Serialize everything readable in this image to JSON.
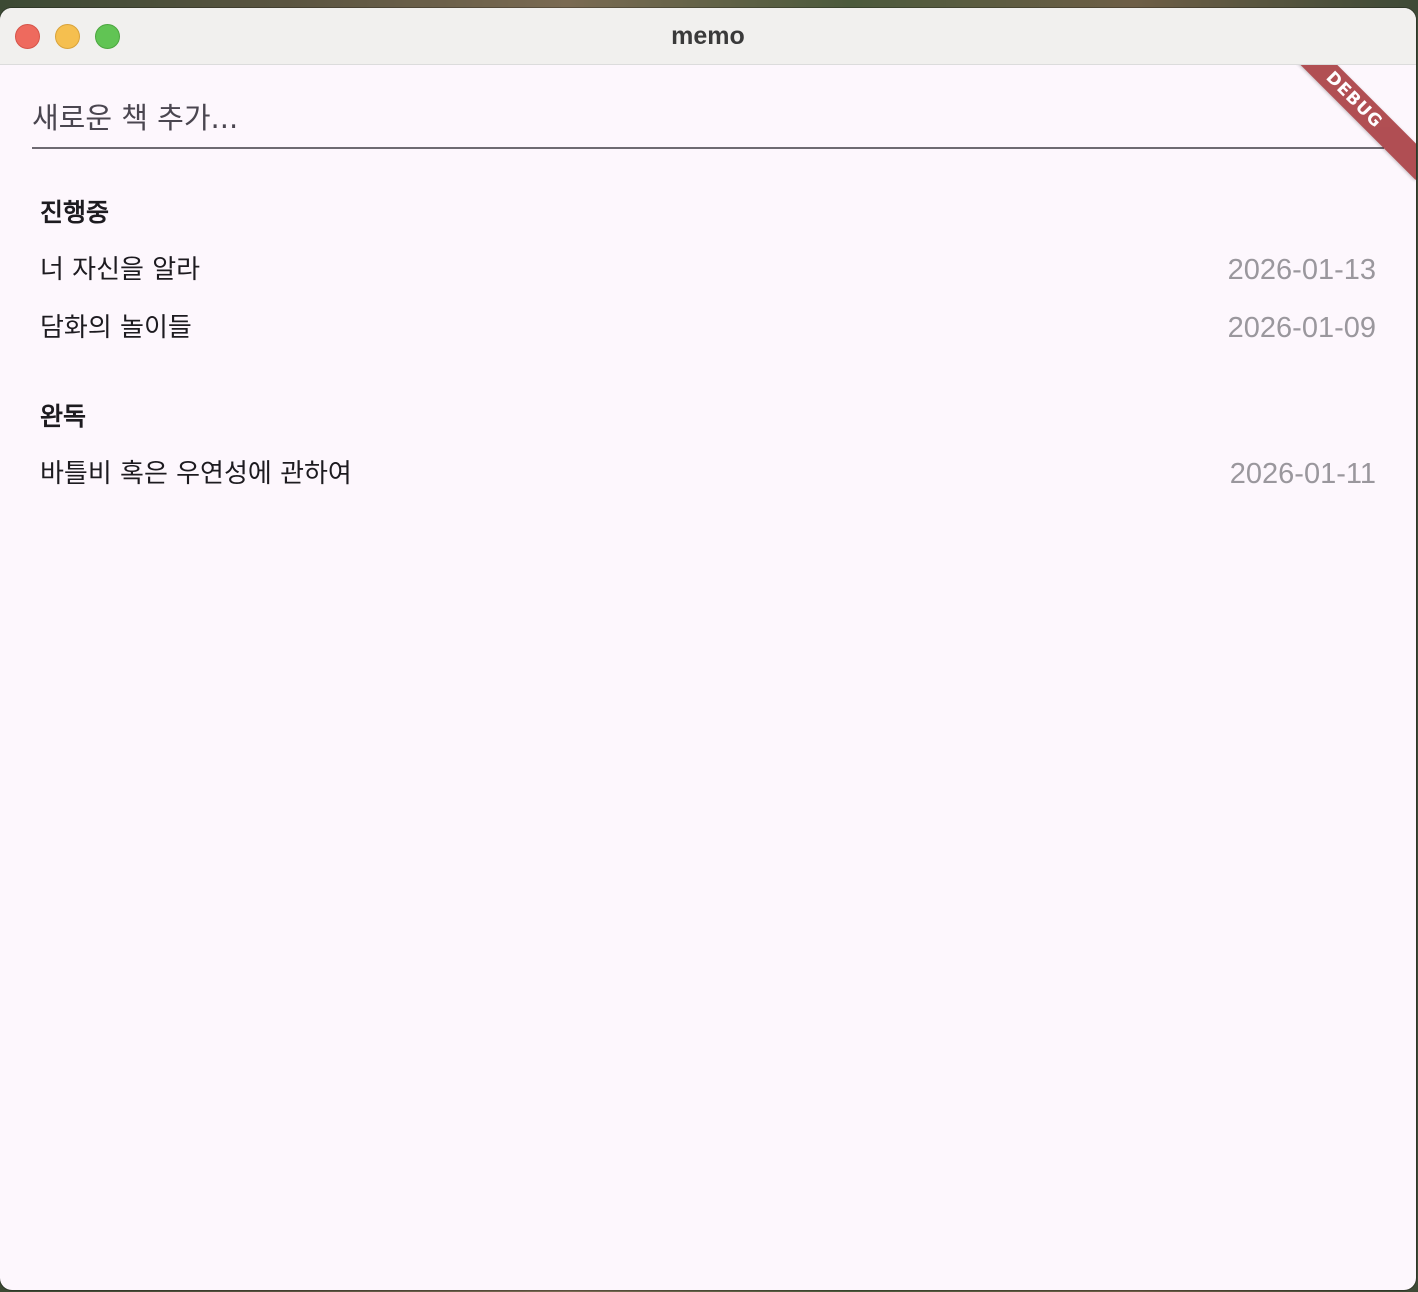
{
  "window": {
    "title": "memo"
  },
  "search": {
    "placeholder": "새로운 책 추가..."
  },
  "debug_banner": "DEBUG",
  "sections": [
    {
      "title": "진행중",
      "books": [
        {
          "title": "너 자신을 알라",
          "date": "2026-01-13"
        },
        {
          "title": "담화의 놀이들",
          "date": "2026-01-09"
        }
      ]
    },
    {
      "title": "완독",
      "books": [
        {
          "title": "바틀비 혹은 우연성에 관하여",
          "date": "2026-01-11"
        }
      ]
    }
  ]
}
